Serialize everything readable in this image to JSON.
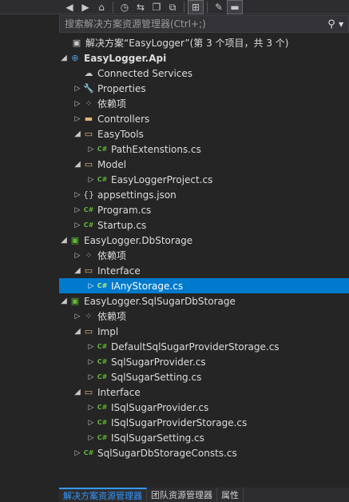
{
  "search": {
    "placeholder": "搜索解决方案资源管理器(Ctrl+;)"
  },
  "toolbar": {
    "buttons": [
      "back-icon",
      "forward-icon",
      "home-icon",
      "history-icon",
      "sync-icon",
      "collapse-icon",
      "files-icon",
      "view-icon",
      "properties-icon",
      "preview-icon"
    ]
  },
  "tree": {
    "rows": [
      {
        "label": "解决方案“EasyLogger”(第 3 个项目，共 3 个)",
        "icon": "solution-icon",
        "arrow": "none",
        "indent": 0
      },
      {
        "label": "EasyLogger.Api",
        "icon": "web-project-icon",
        "arrow": "expanded",
        "indent": 0,
        "bold": true
      },
      {
        "label": "Connected Services",
        "icon": "connected-services-icon",
        "arrow": "none",
        "indent": 1
      },
      {
        "label": "Properties",
        "icon": "wrench-icon",
        "arrow": "collapsed",
        "indent": 1
      },
      {
        "label": "依赖项",
        "icon": "dependencies-icon",
        "arrow": "collapsed",
        "indent": 1
      },
      {
        "label": "Controllers",
        "icon": "folder-icon",
        "arrow": "collapsed",
        "indent": 1
      },
      {
        "label": "EasyTools",
        "icon": "folder-open-icon",
        "arrow": "expanded",
        "indent": 1
      },
      {
        "label": "PathExtenstions.cs",
        "icon": "csharp-icon",
        "arrow": "collapsed",
        "indent": 2
      },
      {
        "label": "Model",
        "icon": "folder-open-icon",
        "arrow": "expanded",
        "indent": 1
      },
      {
        "label": "EasyLoggerProject.cs",
        "icon": "csharp-icon",
        "arrow": "collapsed",
        "indent": 2
      },
      {
        "label": "appsettings.json",
        "icon": "json-icon",
        "arrow": "collapsed",
        "indent": 1
      },
      {
        "label": "Program.cs",
        "icon": "csharp-icon",
        "arrow": "collapsed",
        "indent": 1
      },
      {
        "label": "Startup.cs",
        "icon": "csharp-icon",
        "arrow": "collapsed",
        "indent": 1
      },
      {
        "label": "EasyLogger.DbStorage",
        "icon": "csharp-project-icon",
        "arrow": "expanded",
        "indent": 0
      },
      {
        "label": "依赖项",
        "icon": "dependencies-icon",
        "arrow": "collapsed",
        "indent": 1
      },
      {
        "label": "Interface",
        "icon": "folder-open-icon",
        "arrow": "expanded",
        "indent": 1
      },
      {
        "label": "IAnyStorage.cs",
        "icon": "csharp-icon",
        "arrow": "collapsed",
        "indent": 2,
        "selected": true
      },
      {
        "label": "EasyLogger.SqlSugarDbStorage",
        "icon": "csharp-project-icon",
        "arrow": "expanded",
        "indent": 0
      },
      {
        "label": "依赖项",
        "icon": "dependencies-icon",
        "arrow": "collapsed",
        "indent": 1
      },
      {
        "label": "Impl",
        "icon": "folder-open-icon",
        "arrow": "expanded",
        "indent": 1
      },
      {
        "label": "DefaultSqlSugarProviderStorage.cs",
        "icon": "csharp-icon",
        "arrow": "collapsed",
        "indent": 2
      },
      {
        "label": "SqlSugarProvider.cs",
        "icon": "csharp-icon",
        "arrow": "collapsed",
        "indent": 2
      },
      {
        "label": "SqlSugarSetting.cs",
        "icon": "csharp-icon",
        "arrow": "collapsed",
        "indent": 2
      },
      {
        "label": "Interface",
        "icon": "folder-open-icon",
        "arrow": "expanded",
        "indent": 1
      },
      {
        "label": "ISqlSugarProvider.cs",
        "icon": "csharp-icon",
        "arrow": "collapsed",
        "indent": 2
      },
      {
        "label": "ISqlSugarProviderStorage.cs",
        "icon": "csharp-icon",
        "arrow": "collapsed",
        "indent": 2
      },
      {
        "label": "ISqlSugarSetting.cs",
        "icon": "csharp-icon",
        "arrow": "collapsed",
        "indent": 2
      },
      {
        "label": "SqlSugarDbStorageConsts.cs",
        "icon": "csharp-icon",
        "arrow": "collapsed",
        "indent": 1
      }
    ]
  },
  "bottom_tabs": [
    {
      "label": "解决方案资源管理器",
      "active": true
    },
    {
      "label": "团队资源管理器",
      "active": false
    },
    {
      "label": "属性",
      "active": false
    }
  ],
  "colors": {
    "selection": "#007acc",
    "background": "#252526",
    "csharp": "#5fb832",
    "folder": "#dcb67a"
  }
}
